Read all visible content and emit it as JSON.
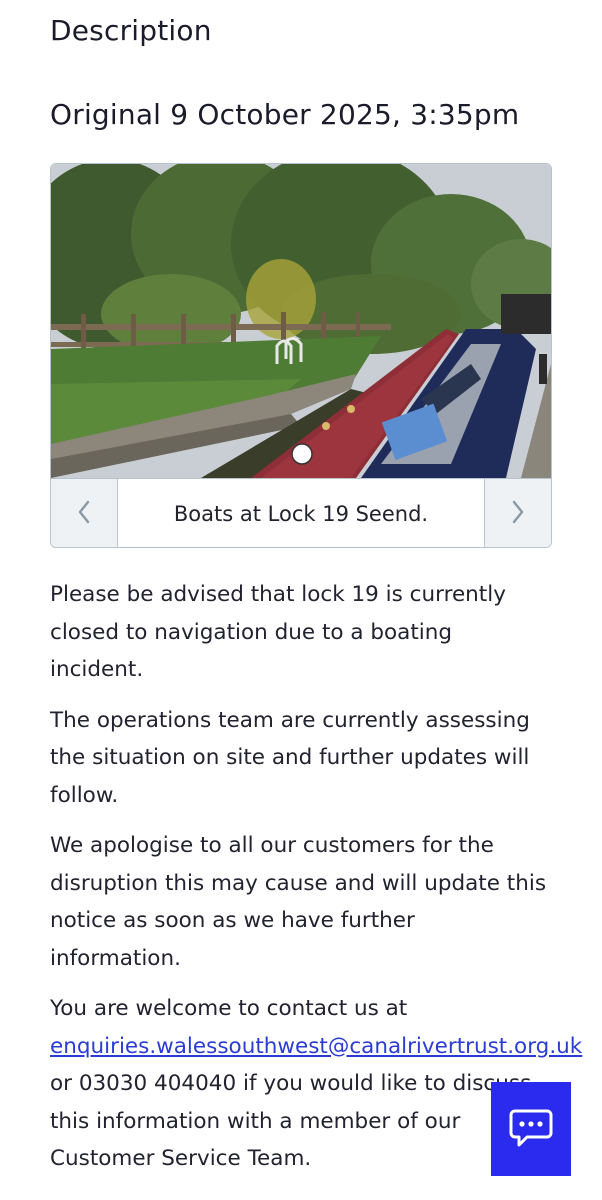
{
  "section_heading": "Description",
  "update_heading": "Original 9 October 2025, 3:35pm",
  "carousel": {
    "caption": "Boats at Lock 19 Seend.",
    "prev_icon": "chevron-left-icon",
    "next_icon": "chevron-right-icon"
  },
  "paragraphs": [
    "Please be advised that lock 19 is currently closed to navigation due to a boating incident.",
    "The operations team are currently assessing the situation on site and further updates will follow.",
    "We apologise to all our customers for the disruption this may cause and will update this notice as soon as we have further information."
  ],
  "contact": {
    "prefix": "You are welcome to contact us at ",
    "email": "enquiries.walessouthwest@canalrivertrust.org.uk",
    "middle": " or 03030 404040 if you would like to discuss this information with a member of our Customer Service Team."
  },
  "chat": {
    "icon": "chat-bubble-icon"
  },
  "colors": {
    "accent": "#2b2bf0",
    "link": "#2a3bd6",
    "border": "#b7c4cf",
    "nav_bg": "#eef2f5"
  }
}
